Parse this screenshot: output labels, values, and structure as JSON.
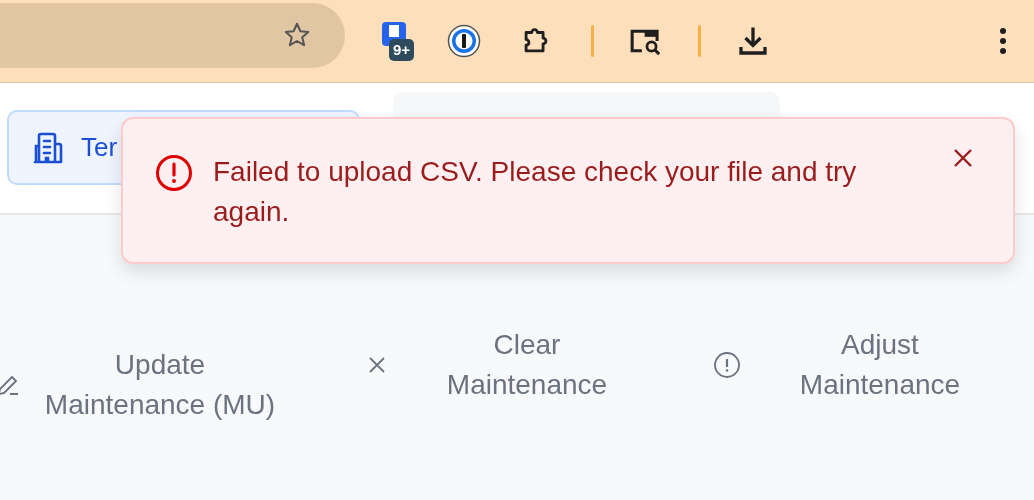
{
  "browser_toolbar": {
    "extension_badge": "9+"
  },
  "page": {
    "tenant_button": {
      "label": "Ter"
    },
    "actions": [
      {
        "kind": "edit",
        "label": "Update Maintenance (MU)"
      },
      {
        "kind": "clear",
        "label": "Clear Maintenance"
      },
      {
        "kind": "adjust",
        "label": "Adjust Maintenance"
      }
    ]
  },
  "toast": {
    "kind": "error",
    "message": "Failed to upload CSV. Please check your file and try again."
  }
}
